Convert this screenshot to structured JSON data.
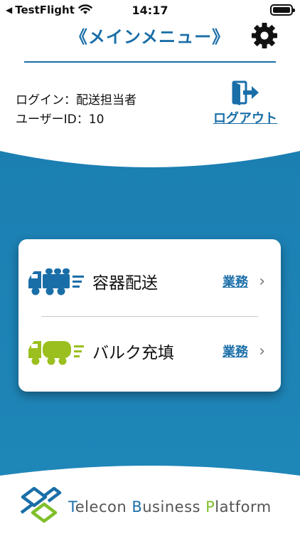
{
  "status_bar": {
    "back_app": "TestFlight",
    "time": "14:17"
  },
  "header": {
    "title": "《メインメニュー》"
  },
  "user": {
    "login_line": "ログイン：配送担当者",
    "user_id_line": "ユーザーID：10"
  },
  "logout": {
    "label": "ログアウト"
  },
  "menu": {
    "items": [
      {
        "label": "容器配送",
        "link": "業務",
        "truck_color": "#1a6ea8"
      },
      {
        "label": "バルク充填",
        "link": "業務",
        "truck_color": "#9bbf1e"
      }
    ]
  },
  "footer": {
    "brand_t": "T",
    "brand_rest1": "elecon ",
    "brand_b": "B",
    "brand_rest2": "usiness ",
    "brand_p": "P",
    "brand_rest3": "latform"
  },
  "colors": {
    "accent": "#1a6ea8",
    "band": "#1b7fb2",
    "green": "#9bbf1e"
  }
}
